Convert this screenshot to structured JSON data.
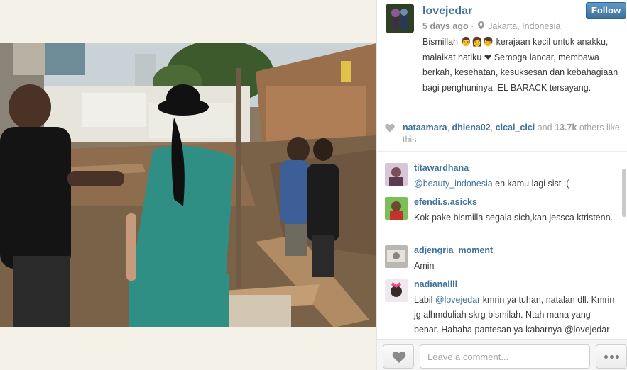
{
  "post": {
    "username": "lovejedar",
    "time_ago": "5 days ago",
    "separator": "·",
    "location": "Jakarta, Indonesia",
    "follow_label": "Follow",
    "caption_before": "Bismillah 👨👩👦 kerajaan kecil untuk anakku, malaikat hatiku",
    "caption_heart": "❤",
    "caption_after": " Semoga lancar, membawa berkah, kesehatan, kesuksesan dan kebahagiaan bagi penghuninya, EL BARACK tersayang."
  },
  "likes": {
    "liker_1": "nataamara",
    "liker_2": "dhlena02",
    "liker_3": "clcal_clcl",
    "and_text": "and",
    "count": "13.7k",
    "others_text": "others like this."
  },
  "comments": [
    {
      "user": "titawardhana",
      "mention": "@beauty_indonesia",
      "text": " eh kamu lagi sist :("
    },
    {
      "user": "efendi.s.asicks",
      "mention": "",
      "text": "Kok pake bismilla segala sich,kan jessca ktristenn.."
    },
    {
      "user": "adjengria_moment",
      "mention": "",
      "text": "Amin"
    },
    {
      "user": "nadianallll",
      "prefix": "Labil ",
      "mention": "@lovejedar",
      "text": " kmrin ya tuhan, natalan dll. Kmrin jg alhmduliah skrg bismilah. Ntah mana yang benar. Hahaha pantesan ya kabarnya @lovejedar dibujuk orang kaya..."
    }
  ],
  "footer": {
    "comment_placeholder": "Leave a comment..."
  },
  "icons": {
    "location": "map-pin-icon",
    "like": "heart-icon",
    "more": "ellipsis-icon"
  },
  "colors": {
    "link_blue": "#3f729b",
    "follow_button": "#3f729b",
    "page_background": "#f4f2e8"
  }
}
